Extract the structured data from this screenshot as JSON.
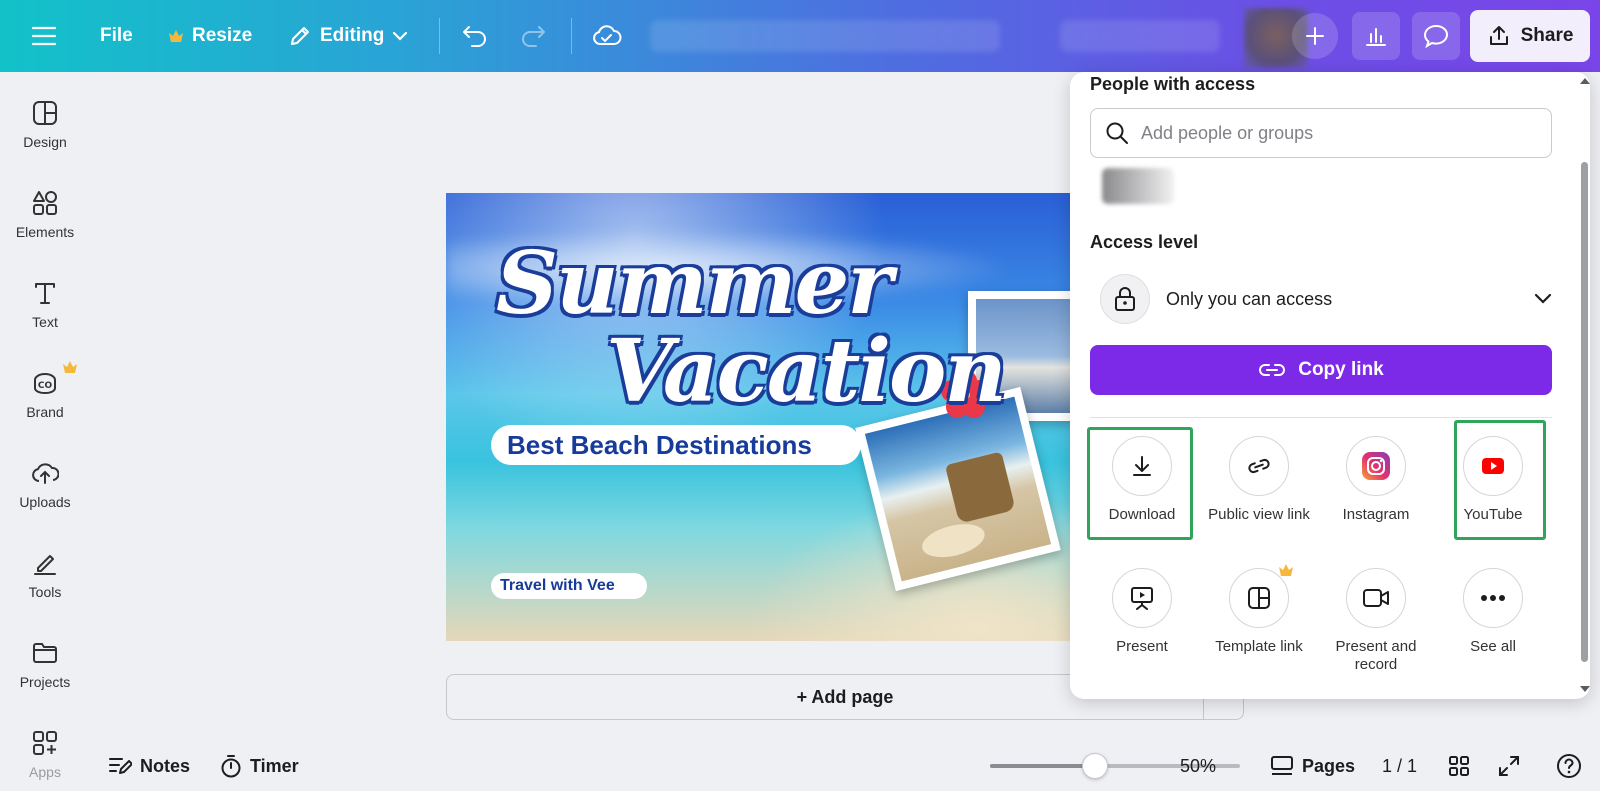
{
  "topbar": {
    "file_label": "File",
    "resize_label": "Resize",
    "editing_label": "Editing",
    "share_label": "Share"
  },
  "sidebar": {
    "items": [
      {
        "label": "Design",
        "icon": "design-icon"
      },
      {
        "label": "Elements",
        "icon": "elements-icon"
      },
      {
        "label": "Text",
        "icon": "text-icon"
      },
      {
        "label": "Brand",
        "icon": "brand-icon"
      },
      {
        "label": "Uploads",
        "icon": "uploads-icon"
      },
      {
        "label": "Tools",
        "icon": "tools-icon"
      },
      {
        "label": "Projects",
        "icon": "projects-icon"
      },
      {
        "label": "Apps",
        "icon": "apps-icon"
      }
    ]
  },
  "design": {
    "title_line1": "Summer",
    "title_line2": "Vacation",
    "subtitle": "Best Beach Destinations",
    "tagline": "Travel with Vee"
  },
  "canvas": {
    "add_page_label": "+ Add page"
  },
  "bottombar": {
    "notes_label": "Notes",
    "timer_label": "Timer",
    "zoom_value": 50,
    "zoom_label": "50%",
    "pages_label": "Pages",
    "page_count": "1 / 1"
  },
  "share_panel": {
    "people_heading": "People with access",
    "search_placeholder": "Add people or groups",
    "access_heading": "Access level",
    "access_value": "Only you can access",
    "copy_link_label": "Copy link",
    "options": [
      {
        "label": "Download",
        "icon": "download-icon"
      },
      {
        "label": "Public view link",
        "icon": "link-icon"
      },
      {
        "label": "Instagram",
        "icon": "instagram-icon"
      },
      {
        "label": "YouTube",
        "icon": "youtube-icon"
      },
      {
        "label": "Present",
        "icon": "present-icon"
      },
      {
        "label": "Template link",
        "icon": "template-icon"
      },
      {
        "label": "Present and record",
        "icon": "record-icon"
      },
      {
        "label": "See all",
        "icon": "more-icon"
      }
    ]
  },
  "colors": {
    "brand_purple": "#7d2ae8",
    "highlight_green": "#2fa45a"
  }
}
